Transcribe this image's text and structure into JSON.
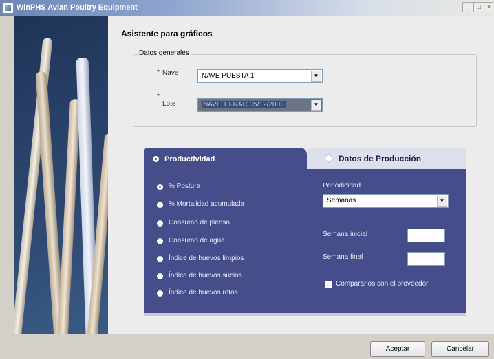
{
  "window": {
    "title": "WinPHS Avian Poultry Equipment",
    "min": "_",
    "max": "□",
    "close": "×"
  },
  "wizard": {
    "title": "Asistente para gráficos"
  },
  "general": {
    "legend": "Datos generales",
    "nave": {
      "label": "Nave",
      "value": "NAVE PUESTA 1"
    },
    "lote": {
      "label": "Lote",
      "value": "NAVE 1 FNAC 05/12/2003"
    }
  },
  "tabs": {
    "active": "Productividad",
    "inactive": "Datos de Producción"
  },
  "options": [
    {
      "label": "% Postura",
      "selected": true
    },
    {
      "label": "% Mortalidad acumulada",
      "selected": false
    },
    {
      "label": "Consumo de pienso",
      "selected": false
    },
    {
      "label": "Consumo de agua",
      "selected": false
    },
    {
      "label": "Índice de huevos limpios",
      "selected": false
    },
    {
      "label": "Índice de huevos sucios",
      "selected": false
    },
    {
      "label": "Índice de huevos rotos",
      "selected": false
    }
  ],
  "right": {
    "periodicidad_label": "Periodicidad",
    "periodicidad_value": "Semanas",
    "semana_inicial": "Semana inicial",
    "semana_final": "Semana final",
    "comparar": "Compararlos con el proveedor"
  },
  "buttons": {
    "aceptar": "Aceptar",
    "cancelar": "Cancelar"
  },
  "colors": {
    "tab_active": "#454d8a",
    "tab_inactive": "#dedfec",
    "window_bg": "#ececec"
  }
}
